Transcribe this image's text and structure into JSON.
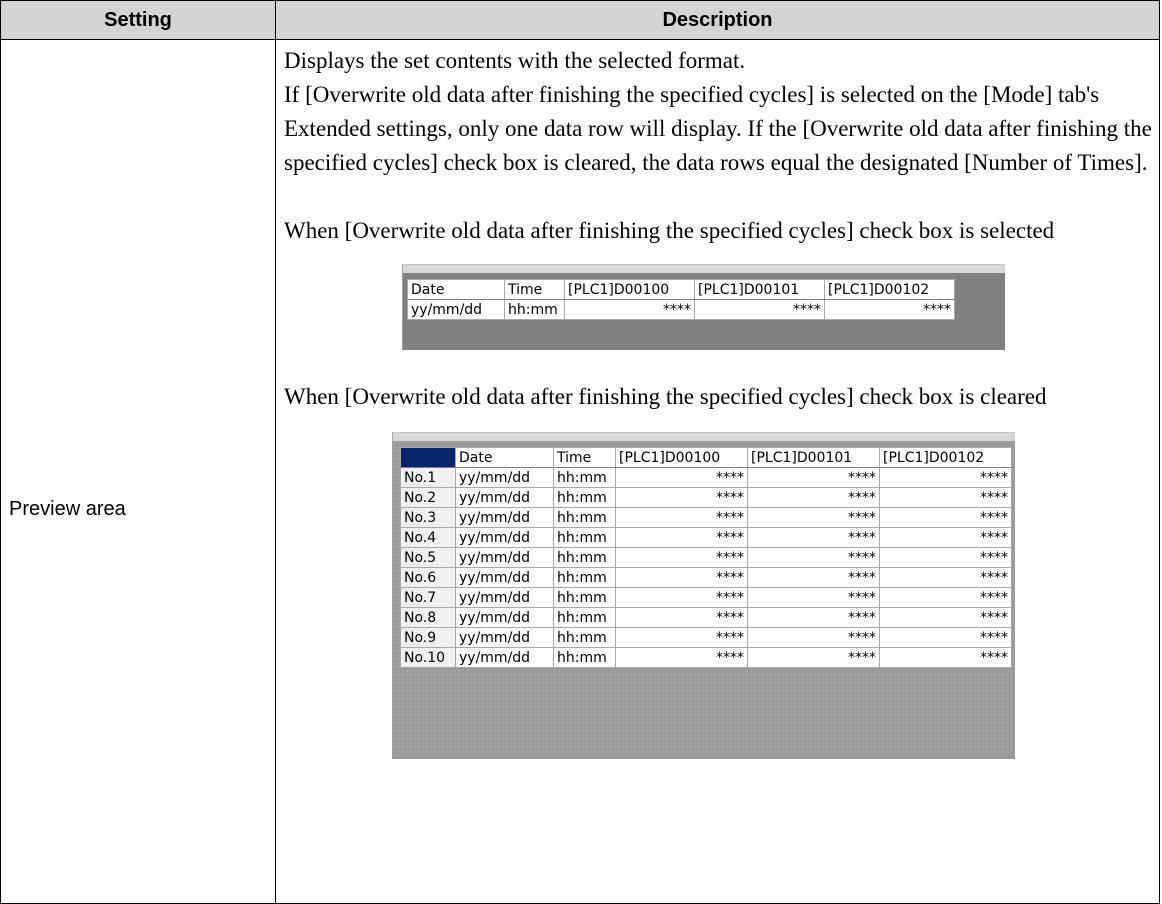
{
  "table": {
    "headers": {
      "setting": "Setting",
      "description": "Description"
    },
    "row": {
      "setting": "Preview area",
      "paragraphs": [
        "Displays the set contents with the selected format.",
        "If [Overwrite old data after finishing the specified cycles] is selected on the [Mode] tab's Extended settings, only one data row will display. If the [Overwrite old data after finishing the specified cycles] check box is cleared, the data rows equal the designated [Number of Times].",
        "When [Overwrite old data after finishing the specified cycles] check box is selected",
        "When [Overwrite old data after finishing the specified cycles] check box is cleared"
      ]
    }
  },
  "preview_selected": {
    "columns": [
      "Date",
      "Time",
      "[PLC1]D00100",
      "[PLC1]D00101",
      "[PLC1]D00102"
    ],
    "row": [
      "yy/mm/dd",
      "hh:mm",
      "****",
      "****",
      "****"
    ]
  },
  "preview_cleared": {
    "columns": [
      "",
      "Date",
      "Time",
      "[PLC1]D00100",
      "[PLC1]D00101",
      "[PLC1]D00102"
    ],
    "rows": [
      [
        "No.1",
        "yy/mm/dd",
        "hh:mm",
        "****",
        "****",
        "****"
      ],
      [
        "No.2",
        "yy/mm/dd",
        "hh:mm",
        "****",
        "****",
        "****"
      ],
      [
        "No.3",
        "yy/mm/dd",
        "hh:mm",
        "****",
        "****",
        "****"
      ],
      [
        "No.4",
        "yy/mm/dd",
        "hh:mm",
        "****",
        "****",
        "****"
      ],
      [
        "No.5",
        "yy/mm/dd",
        "hh:mm",
        "****",
        "****",
        "****"
      ],
      [
        "No.6",
        "yy/mm/dd",
        "hh:mm",
        "****",
        "****",
        "****"
      ],
      [
        "No.7",
        "yy/mm/dd",
        "hh:mm",
        "****",
        "****",
        "****"
      ],
      [
        "No.8",
        "yy/mm/dd",
        "hh:mm",
        "****",
        "****",
        "****"
      ],
      [
        "No.9",
        "yy/mm/dd",
        "hh:mm",
        "****",
        "****",
        "****"
      ],
      [
        "No.10",
        "yy/mm/dd",
        "hh:mm",
        "****",
        "****",
        "****"
      ]
    ]
  },
  "colors": {
    "header_bg": "#d4d4d4",
    "corner_cell": "#0a246a"
  }
}
